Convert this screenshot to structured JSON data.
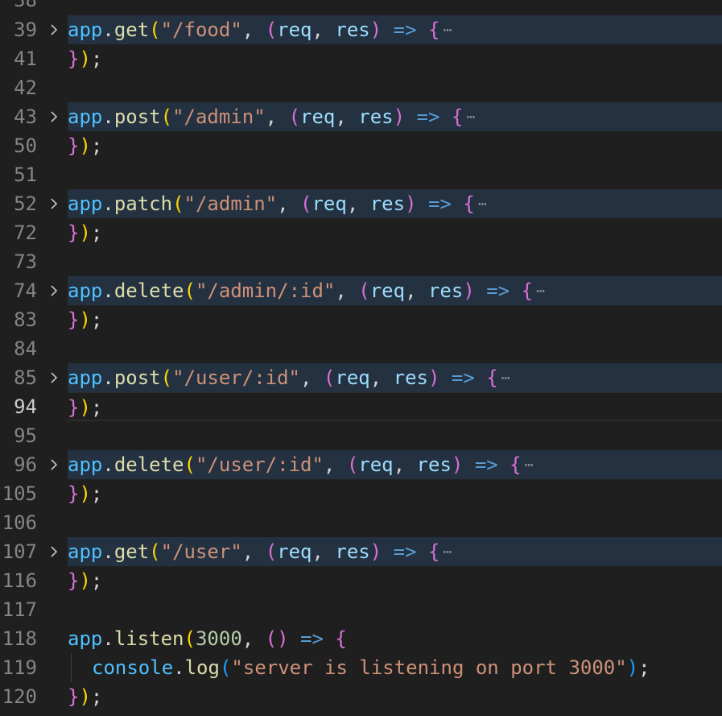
{
  "editor": {
    "top_partial_line_number": "38",
    "lines": [
      {
        "num": "39",
        "folded": true,
        "tokens": [
          [
            "app",
            "t-var"
          ],
          [
            ".",
            "t-op"
          ],
          [
            "get",
            "t-fn"
          ],
          [
            "(",
            "t-b1"
          ],
          [
            "\"/food\"",
            "t-str"
          ],
          [
            ", ",
            "t-op"
          ],
          [
            "(",
            "t-b2"
          ],
          [
            "req",
            "t-id"
          ],
          [
            ", ",
            "t-op"
          ],
          [
            "res",
            "t-id"
          ],
          [
            ")",
            "t-b2"
          ],
          [
            " ",
            "t-op"
          ],
          [
            "=>",
            "t-kw"
          ],
          [
            " ",
            "t-op"
          ],
          [
            "{",
            "t-b2"
          ]
        ]
      },
      {
        "num": "41",
        "folded": false,
        "tokens": [
          [
            "}",
            "t-b2"
          ],
          [
            ")",
            "t-b1"
          ],
          [
            ";",
            "t-op"
          ]
        ]
      },
      {
        "num": "42",
        "folded": false,
        "tokens": []
      },
      {
        "num": "43",
        "folded": true,
        "tokens": [
          [
            "app",
            "t-var"
          ],
          [
            ".",
            "t-op"
          ],
          [
            "post",
            "t-fn"
          ],
          [
            "(",
            "t-b1"
          ],
          [
            "\"/admin\"",
            "t-str"
          ],
          [
            ", ",
            "t-op"
          ],
          [
            "(",
            "t-b2"
          ],
          [
            "req",
            "t-id"
          ],
          [
            ", ",
            "t-op"
          ],
          [
            "res",
            "t-id"
          ],
          [
            ")",
            "t-b2"
          ],
          [
            " ",
            "t-op"
          ],
          [
            "=>",
            "t-kw"
          ],
          [
            " ",
            "t-op"
          ],
          [
            "{",
            "t-b2"
          ]
        ]
      },
      {
        "num": "50",
        "folded": false,
        "tokens": [
          [
            "}",
            "t-b2"
          ],
          [
            ")",
            "t-b1"
          ],
          [
            ";",
            "t-op"
          ]
        ]
      },
      {
        "num": "51",
        "folded": false,
        "tokens": []
      },
      {
        "num": "52",
        "folded": true,
        "tokens": [
          [
            "app",
            "t-var"
          ],
          [
            ".",
            "t-op"
          ],
          [
            "patch",
            "t-fn"
          ],
          [
            "(",
            "t-b1"
          ],
          [
            "\"/admin\"",
            "t-str"
          ],
          [
            ", ",
            "t-op"
          ],
          [
            "(",
            "t-b2"
          ],
          [
            "req",
            "t-id"
          ],
          [
            ", ",
            "t-op"
          ],
          [
            "res",
            "t-id"
          ],
          [
            ")",
            "t-b2"
          ],
          [
            " ",
            "t-op"
          ],
          [
            "=>",
            "t-kw"
          ],
          [
            " ",
            "t-op"
          ],
          [
            "{",
            "t-b2"
          ]
        ]
      },
      {
        "num": "72",
        "folded": false,
        "tokens": [
          [
            "}",
            "t-b2"
          ],
          [
            ")",
            "t-b1"
          ],
          [
            ";",
            "t-op"
          ]
        ]
      },
      {
        "num": "73",
        "folded": false,
        "tokens": []
      },
      {
        "num": "74",
        "folded": true,
        "tokens": [
          [
            "app",
            "t-var"
          ],
          [
            ".",
            "t-op"
          ],
          [
            "delete",
            "t-fn"
          ],
          [
            "(",
            "t-b1"
          ],
          [
            "\"/admin/:id\"",
            "t-str"
          ],
          [
            ", ",
            "t-op"
          ],
          [
            "(",
            "t-b2"
          ],
          [
            "req",
            "t-id"
          ],
          [
            ", ",
            "t-op"
          ],
          [
            "res",
            "t-id"
          ],
          [
            ")",
            "t-b2"
          ],
          [
            " ",
            "t-op"
          ],
          [
            "=>",
            "t-kw"
          ],
          [
            " ",
            "t-op"
          ],
          [
            "{",
            "t-b2"
          ]
        ]
      },
      {
        "num": "83",
        "folded": false,
        "tokens": [
          [
            "}",
            "t-b2"
          ],
          [
            ")",
            "t-b1"
          ],
          [
            ";",
            "t-op"
          ]
        ]
      },
      {
        "num": "84",
        "folded": false,
        "tokens": []
      },
      {
        "num": "85",
        "folded": true,
        "tokens": [
          [
            "app",
            "t-var"
          ],
          [
            ".",
            "t-op"
          ],
          [
            "post",
            "t-fn"
          ],
          [
            "(",
            "t-b1"
          ],
          [
            "\"/user/:id\"",
            "t-str"
          ],
          [
            ", ",
            "t-op"
          ],
          [
            "(",
            "t-b2"
          ],
          [
            "req",
            "t-id"
          ],
          [
            ", ",
            "t-op"
          ],
          [
            "res",
            "t-id"
          ],
          [
            ")",
            "t-b2"
          ],
          [
            " ",
            "t-op"
          ],
          [
            "=>",
            "t-kw"
          ],
          [
            " ",
            "t-op"
          ],
          [
            "{",
            "t-b2"
          ]
        ]
      },
      {
        "num": "94",
        "folded": false,
        "current": true,
        "tokens": [
          [
            "}",
            "t-b2"
          ],
          [
            ")",
            "t-b1"
          ],
          [
            ";",
            "t-op"
          ]
        ]
      },
      {
        "num": "95",
        "folded": false,
        "tokens": []
      },
      {
        "num": "96",
        "folded": true,
        "tokens": [
          [
            "app",
            "t-var"
          ],
          [
            ".",
            "t-op"
          ],
          [
            "delete",
            "t-fn"
          ],
          [
            "(",
            "t-b1"
          ],
          [
            "\"/user/:id\"",
            "t-str"
          ],
          [
            ", ",
            "t-op"
          ],
          [
            "(",
            "t-b2"
          ],
          [
            "req",
            "t-id"
          ],
          [
            ", ",
            "t-op"
          ],
          [
            "res",
            "t-id"
          ],
          [
            ")",
            "t-b2"
          ],
          [
            " ",
            "t-op"
          ],
          [
            "=>",
            "t-kw"
          ],
          [
            " ",
            "t-op"
          ],
          [
            "{",
            "t-b2"
          ]
        ]
      },
      {
        "num": "105",
        "folded": false,
        "tokens": [
          [
            "}",
            "t-b2"
          ],
          [
            ")",
            "t-b1"
          ],
          [
            ";",
            "t-op"
          ]
        ]
      },
      {
        "num": "106",
        "folded": false,
        "tokens": []
      },
      {
        "num": "107",
        "folded": true,
        "tokens": [
          [
            "app",
            "t-var"
          ],
          [
            ".",
            "t-op"
          ],
          [
            "get",
            "t-fn"
          ],
          [
            "(",
            "t-b1"
          ],
          [
            "\"/user\"",
            "t-str"
          ],
          [
            ", ",
            "t-op"
          ],
          [
            "(",
            "t-b2"
          ],
          [
            "req",
            "t-id"
          ],
          [
            ", ",
            "t-op"
          ],
          [
            "res",
            "t-id"
          ],
          [
            ")",
            "t-b2"
          ],
          [
            " ",
            "t-op"
          ],
          [
            "=>",
            "t-kw"
          ],
          [
            " ",
            "t-op"
          ],
          [
            "{",
            "t-b2"
          ]
        ]
      },
      {
        "num": "116",
        "folded": false,
        "tokens": [
          [
            "}",
            "t-b2"
          ],
          [
            ")",
            "t-b1"
          ],
          [
            ";",
            "t-op"
          ]
        ]
      },
      {
        "num": "117",
        "folded": false,
        "tokens": []
      },
      {
        "num": "118",
        "folded": false,
        "tokens": [
          [
            "app",
            "t-var"
          ],
          [
            ".",
            "t-op"
          ],
          [
            "listen",
            "t-fn"
          ],
          [
            "(",
            "t-b1"
          ],
          [
            "3000",
            "t-num"
          ],
          [
            ", ",
            "t-op"
          ],
          [
            "()",
            "t-b2"
          ],
          [
            " ",
            "t-op"
          ],
          [
            "=>",
            "t-kw"
          ],
          [
            " ",
            "t-op"
          ],
          [
            "{",
            "t-b2"
          ]
        ]
      },
      {
        "num": "119",
        "folded": false,
        "indented": true,
        "tokens": [
          [
            "console",
            "t-var"
          ],
          [
            ".",
            "t-op"
          ],
          [
            "log",
            "t-fn"
          ],
          [
            "(",
            "t-b3"
          ],
          [
            "\"server is listening on port 3000\"",
            "t-str"
          ],
          [
            ")",
            "t-b3"
          ],
          [
            ";",
            "t-op"
          ]
        ]
      },
      {
        "num": "120",
        "folded": false,
        "tokens": [
          [
            "}",
            "t-b2"
          ],
          [
            ")",
            "t-b1"
          ],
          [
            ";",
            "t-op"
          ]
        ]
      }
    ],
    "fold_ellipsis": "⋯",
    "fold_icon": "chevron-right-icon"
  }
}
